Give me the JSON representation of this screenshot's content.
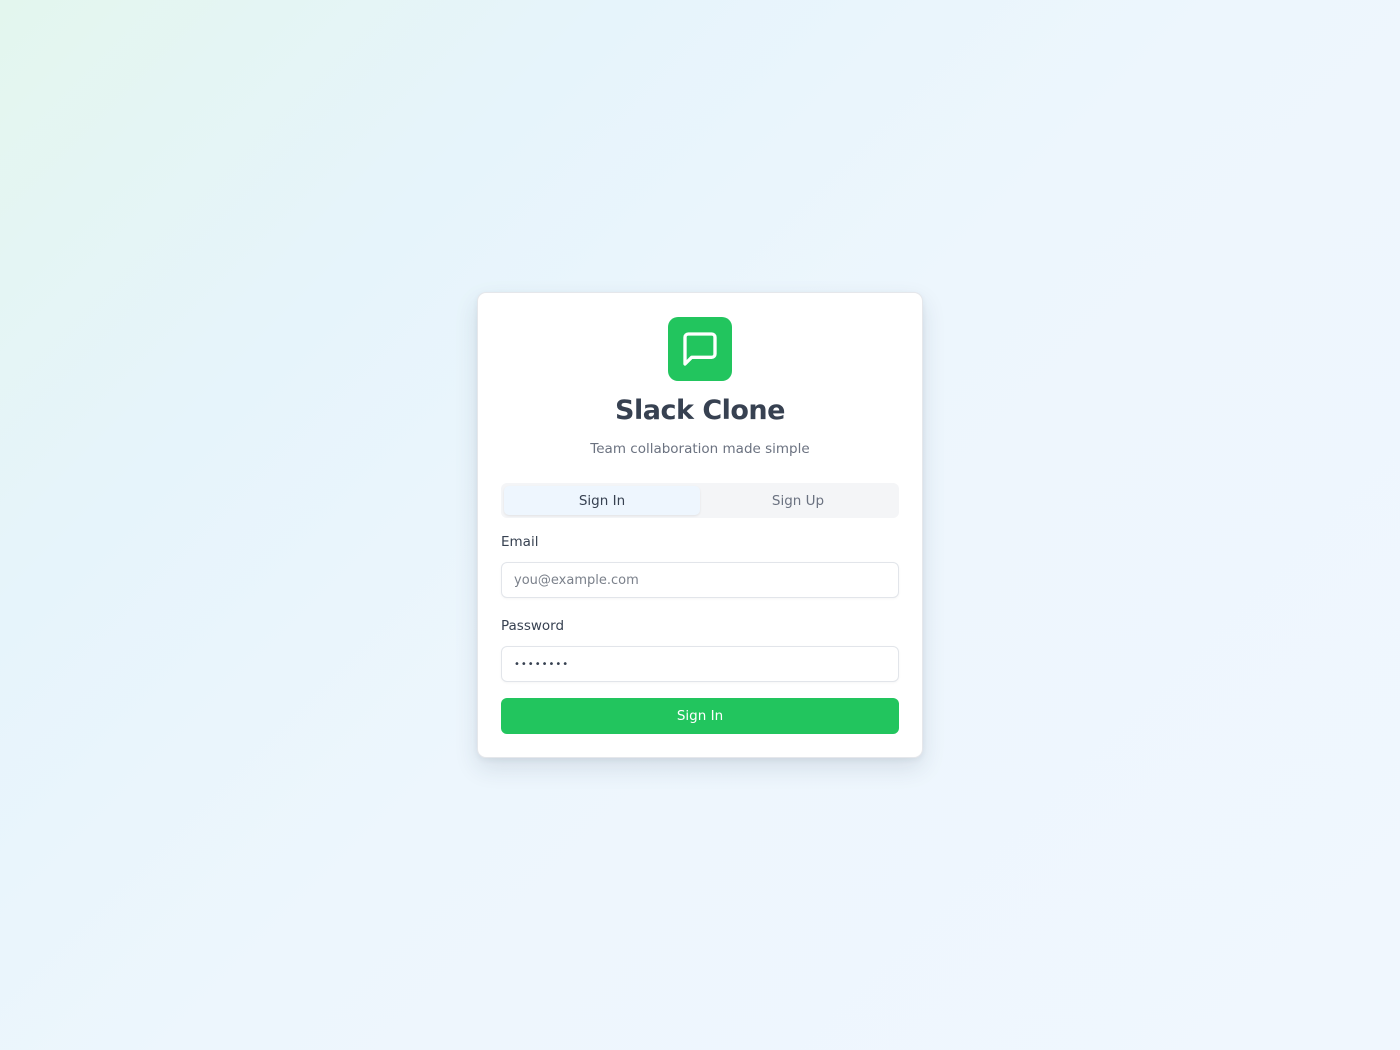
{
  "app": {
    "title": "Slack Clone",
    "subtitle": "Team collaboration made simple",
    "logo_icon": "chat-bubble-icon",
    "accent_color": "#22c55e"
  },
  "tabs": [
    {
      "label": "Sign In",
      "active": true
    },
    {
      "label": "Sign Up",
      "active": false
    }
  ],
  "form": {
    "email": {
      "label": "Email",
      "placeholder": "you@example.com",
      "value": ""
    },
    "password": {
      "label": "Password",
      "value": "••••••••"
    },
    "submit_label": "Sign In"
  }
}
